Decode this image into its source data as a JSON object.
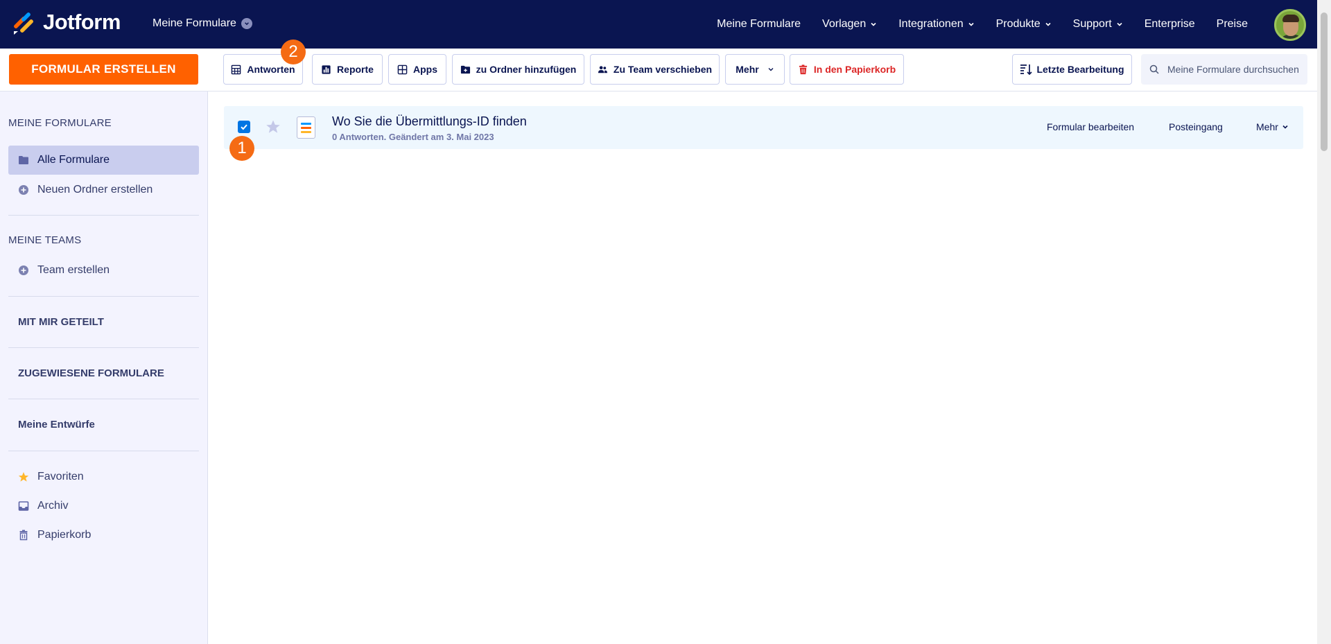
{
  "header": {
    "brand": "Jotform",
    "workspace_label": "Meine Formulare",
    "nav": [
      {
        "label": "Meine Formulare",
        "dropdown": false
      },
      {
        "label": "Vorlagen",
        "dropdown": true
      },
      {
        "label": "Integrationen",
        "dropdown": true
      },
      {
        "label": "Produkte",
        "dropdown": true
      },
      {
        "label": "Support",
        "dropdown": true
      },
      {
        "label": "Enterprise",
        "dropdown": false
      },
      {
        "label": "Preise",
        "dropdown": false
      }
    ]
  },
  "toolbar": {
    "create_label": "FORMULAR ERSTELLEN",
    "responses_label": "Antworten",
    "reports_label": "Reporte",
    "apps_label": "Apps",
    "folder_label": "zu Ordner hinzufügen",
    "team_label": "Zu Team verschieben",
    "more_label": "Mehr",
    "trash_label": "In den Papierkorb",
    "sort_label": "Letzte Bearbeitung",
    "search_placeholder": "Meine Formulare durchsuchen"
  },
  "badges": {
    "step1": "1",
    "step2": "2"
  },
  "sidebar": {
    "my_forms_heading": "MEINE FORMULARE",
    "all_forms": "Alle Formulare",
    "new_folder": "Neuen Ordner erstellen",
    "my_teams_heading": "MEINE TEAMS",
    "create_team": "Team erstellen",
    "shared_with_me": "MIT MIR GETEILT",
    "assigned_forms": "ZUGEWIESENE FORMULARE",
    "my_drafts": "Meine Entwürfe",
    "favorites": "Favoriten",
    "archive": "Archiv",
    "trash": "Papierkorb"
  },
  "forms": [
    {
      "title": "Wo Sie die Übermittlungs-ID finden",
      "meta": "0 Antworten. Geändert am 3. Mai 2023",
      "selected": true,
      "starred": false,
      "actions": {
        "edit": "Formular bearbeiten",
        "inbox": "Posteingang",
        "more": "Mehr"
      }
    }
  ],
  "colors": {
    "header_bg": "#0a1551",
    "accent_orange": "#ff6100",
    "danger": "#dc2626",
    "checkbox_blue": "#0075e3",
    "sidebar_bg": "#f3f3fe",
    "selected_row_bg": "#eef7fe"
  }
}
